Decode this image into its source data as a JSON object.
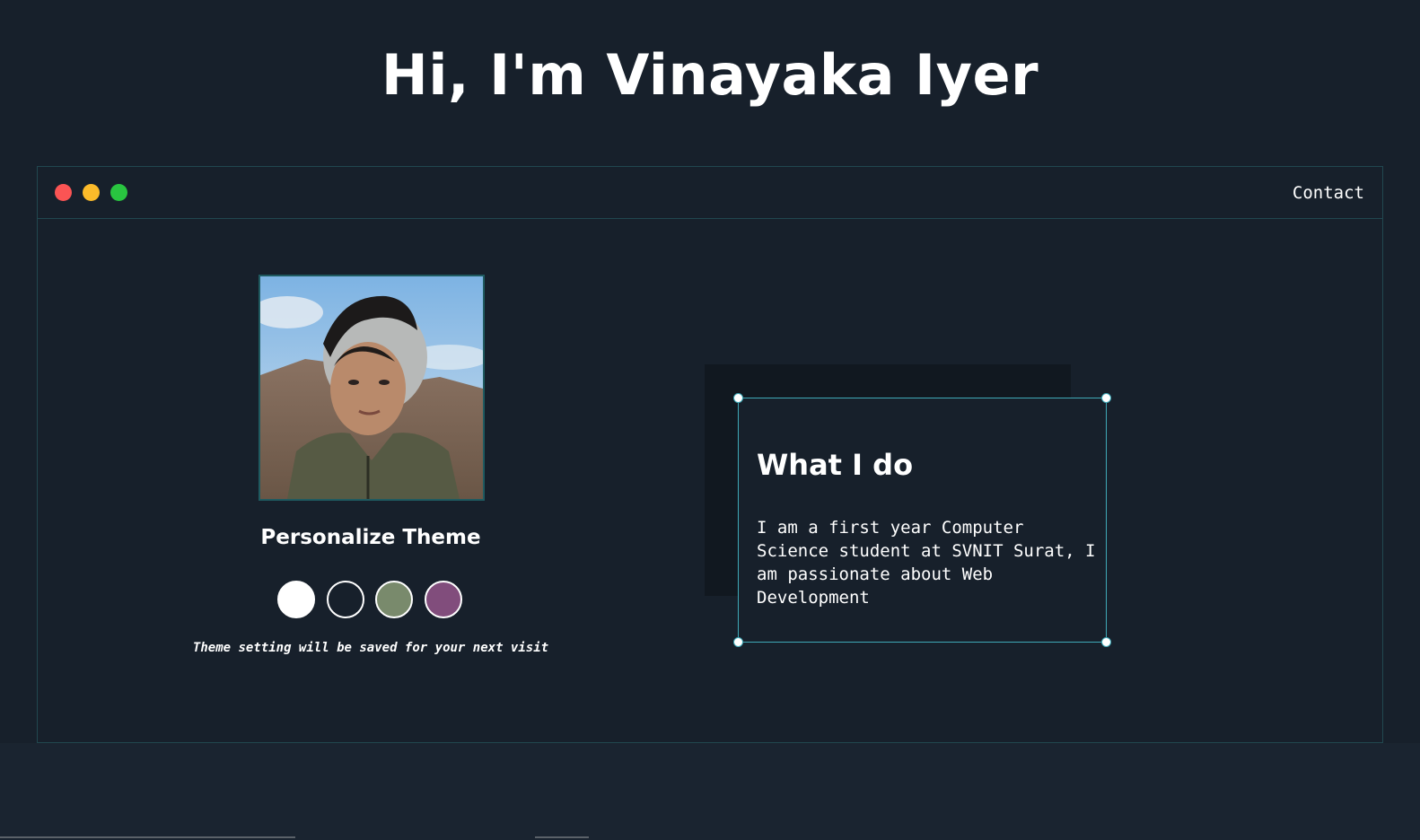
{
  "hero": {
    "title": "Hi, I'm Vinayaka Iyer"
  },
  "window": {
    "controls": [
      "close",
      "minimize",
      "maximize"
    ],
    "control_colors": {
      "close": "#fb5454",
      "minimize": "#fcbb2a",
      "maximize": "#29c540"
    },
    "nav": {
      "contact_label": "Contact"
    }
  },
  "profile": {
    "photo_icon": "profile-photo"
  },
  "theme": {
    "title": "Personalize Theme",
    "swatches": [
      {
        "name": "white",
        "color": "#ffffff"
      },
      {
        "name": "dark-navy",
        "color": "#17202b"
      },
      {
        "name": "sage-green",
        "color": "#798a6c"
      },
      {
        "name": "plum",
        "color": "#814d7c"
      }
    ],
    "note": "Theme setting will be saved for your next visit"
  },
  "about": {
    "title": "What I do",
    "body": "I am a first year Computer Science student at SVNIT Surat, I am passionate about Web Development"
  },
  "colors": {
    "background": "#17202b",
    "border_accent": "#21474f",
    "card_border": "#3fa9b7"
  }
}
